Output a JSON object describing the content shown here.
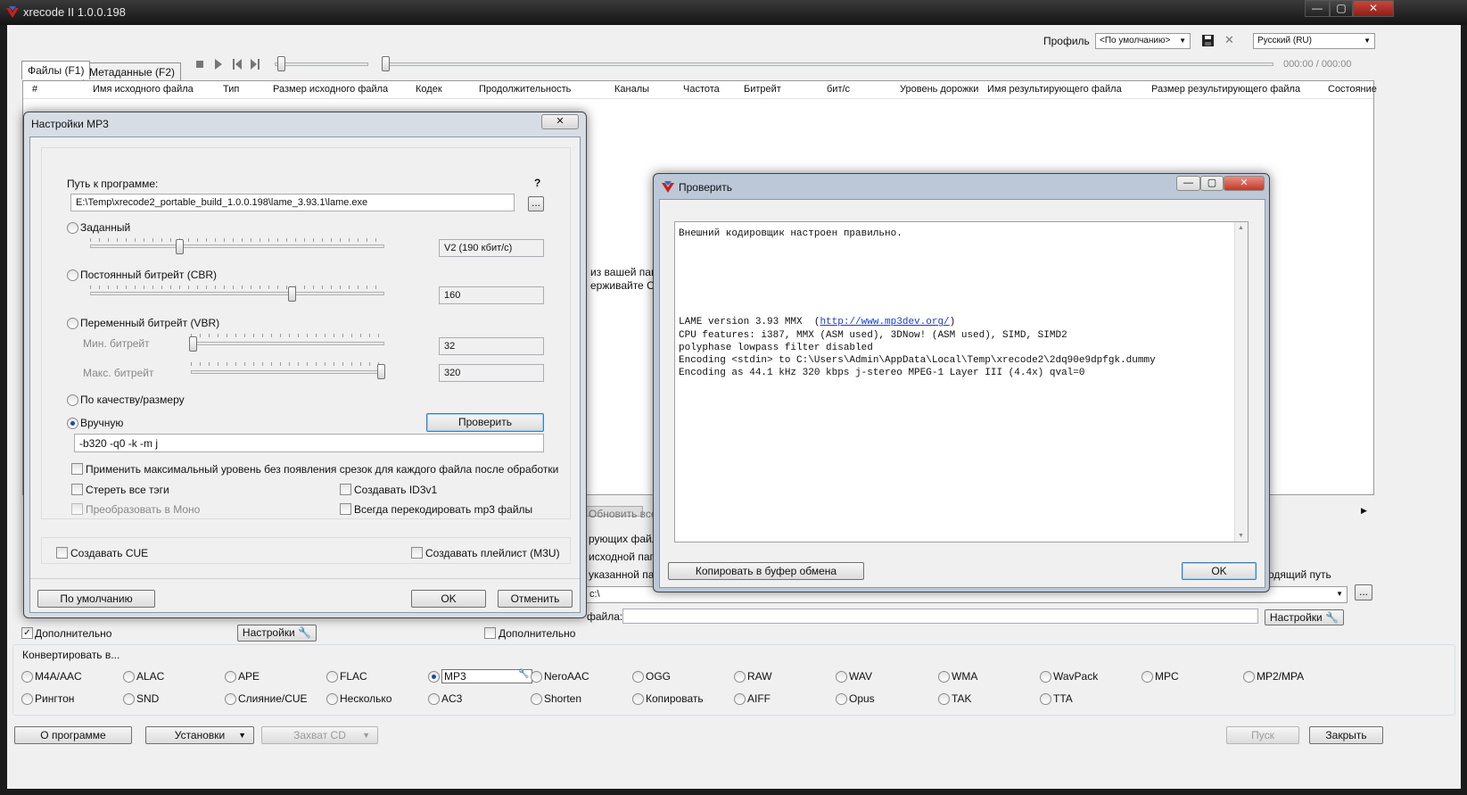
{
  "app": {
    "title": "xrecode II 1.0.0.198"
  },
  "window_controls": {
    "minimize": "—",
    "maximize": "▢",
    "close": "✕"
  },
  "toolbar": {
    "profile_label": "Профиль",
    "profile_value": "<По умолчанию>",
    "language_value": "Русский (RU)",
    "time_display": "000:00 / 000:00"
  },
  "tabs": [
    "Файлы (F1)",
    "Метаданные (F2)"
  ],
  "table": {
    "columns": [
      "#",
      "Имя исходного файла",
      "Тип",
      "Размер исходного файла",
      "Кодек",
      "Продолжительность",
      "Каналы",
      "Частота",
      "Битрейт",
      "бит/с",
      "Уровень дорожки",
      "Имя результирующего файла",
      "Размер результирующего файла",
      "Состояние"
    ]
  },
  "background_fragments": {
    "hint1": "из вашей пап",
    "hint2": "ерживайте Ctrl",
    "refresh": "Обновить все",
    "r1": "рующих файло",
    "r2": "исходной пап",
    "r3": "указанной па",
    "path_suffix": "c:\\",
    "keep_path": "одящий путь",
    "file_label": "файла:"
  },
  "bottom_bar": {
    "extra1": "Дополнительно",
    "settings1": "Настройки",
    "extra2": "Дополнительно",
    "settings2": "Настройки",
    "convert_to": "Конвертировать в...",
    "formats_row1": [
      "M4A/AAC",
      "ALAC",
      "APE",
      "FLAC",
      "MP3",
      "NeroAAC",
      "OGG",
      "RAW",
      "WAV",
      "WMA",
      "WavPack",
      "MPC",
      "MP2/MPA"
    ],
    "formats_row2": [
      "Рингтон",
      "SND",
      "Слияние/CUE",
      "Несколько",
      "AC3",
      "Shorten",
      "Копировать",
      "AIFF",
      "Opus",
      "TAK",
      "TTA"
    ],
    "selected_format": "MP3",
    "about": "О программе",
    "setup": "Установки",
    "capture_cd": "Захват CD",
    "start": "Пуск",
    "close": "Закрыть"
  },
  "mp3_dialog": {
    "title": "Настройки MP3",
    "path_label": "Путь к программе:",
    "help": "?",
    "path_value": "E:\\Temp\\xrecode2_portable_build_1.0.0.198\\lame_3.93.1\\lame.exe",
    "browse": "...",
    "preset_label": "Заданный",
    "preset_value": "V2 (190 кбит/с)",
    "cbr_label": "Постоянный битрейт (CBR)",
    "cbr_value": "160",
    "vbr_label": "Переменный битрейт (VBR)",
    "vbr_min_label": "Мин. битрейт",
    "vbr_min_value": "32",
    "vbr_max_label": "Макс. битрейт",
    "vbr_max_value": "320",
    "quality_label": "По качеству/размеру",
    "manual_label": "Вручную",
    "check_button": "Проверить",
    "manual_value": "-b320 -q0 -k -m j",
    "apply_max_level": "Применить максимальный уровень без появления срезок для каждого файла после обработки",
    "erase_tags": "Стереть все тэги",
    "create_id3v1": "Создавать ID3v1",
    "to_mono": "Преобразовать в Моно",
    "always_recode": "Всегда перекодировать mp3 файлы",
    "create_cue": "Создавать CUE",
    "create_playlist": "Создавать плейлист (M3U)",
    "default_button": "По умолчанию",
    "ok_button": "OK",
    "cancel_button": "Отменить",
    "selected_mode": "manual"
  },
  "check_dialog": {
    "title": "Проверить",
    "log_lines": [
      "Внешний кодировщик настроен правильно.",
      "",
      "",
      "",
      "",
      "",
      "",
      "LAME version 3.93 MMX  (",
      "CPU features: i387, MMX (ASM used), 3DNow! (ASM used), SIMD, SIMD2",
      "polyphase lowpass filter disabled",
      "Encoding <stdin> to C:\\Users\\Admin\\AppData\\Local\\Temp\\xrecode2\\2dq90e9dpfgk.dummy",
      "Encoding as 44.1 kHz 320 kbps j-stereo MPEG-1 Layer III (4.4x) qval=0"
    ],
    "log_link": "http://www.mp3dev.org/",
    "log_link_suffix": ")",
    "copy_button": "Копировать в буфер обмена",
    "ok_button": "OK"
  }
}
